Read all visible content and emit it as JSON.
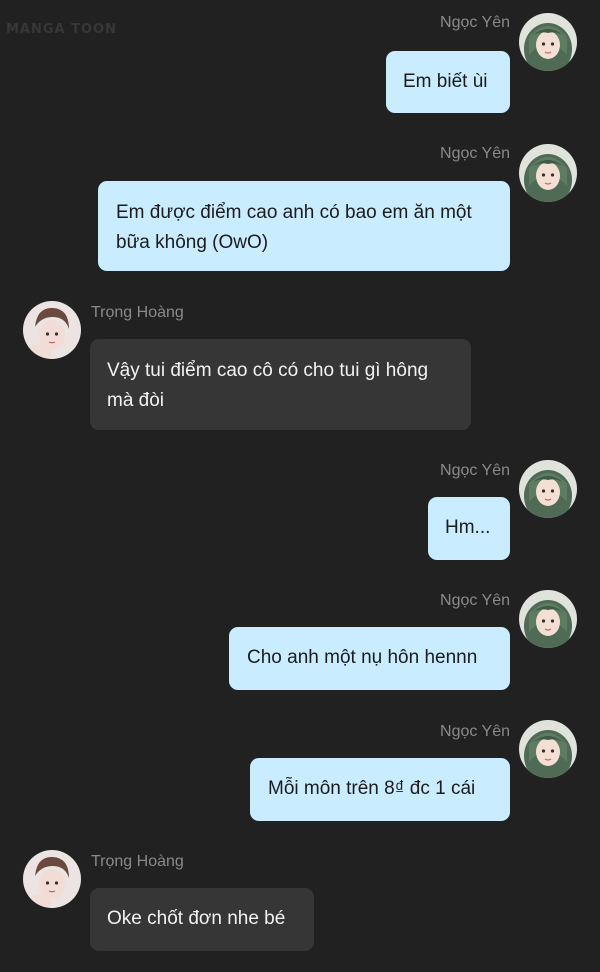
{
  "watermark": "MANGA TOON",
  "messages": [
    {
      "sender": "Ngọc Yên",
      "side": "right",
      "text": "Em biết ùi"
    },
    {
      "sender": "Ngọc Yên",
      "side": "right",
      "text": "Em được điểm cao anh có bao em ăn một bữa không (OwO)"
    },
    {
      "sender": "Trọng Hoàng",
      "side": "left",
      "text": "Vậy tui điểm cao cô có cho tui gì hông mà đòi"
    },
    {
      "sender": "Ngọc Yên",
      "side": "right",
      "text": "Hm..."
    },
    {
      "sender": "Ngọc Yên",
      "side": "right",
      "text": "Cho anh một nụ hôn hennn"
    },
    {
      "sender": "Ngọc Yên",
      "side": "right",
      "text": "Mỗi môn trên 8₫ đc 1 cái"
    },
    {
      "sender": "Trọng Hoàng",
      "side": "left",
      "text": "Oke chốt đơn nhe bé"
    }
  ],
  "avatars": {
    "ngoc_yen": "girl-green-hair-avatar",
    "trong_hoang": "boy-brown-hair-avatar"
  },
  "colors": {
    "background": "#212121",
    "sent_bubble": "#c9ecff",
    "received_bubble": "#363636",
    "name_text": "#8a8a8a"
  }
}
